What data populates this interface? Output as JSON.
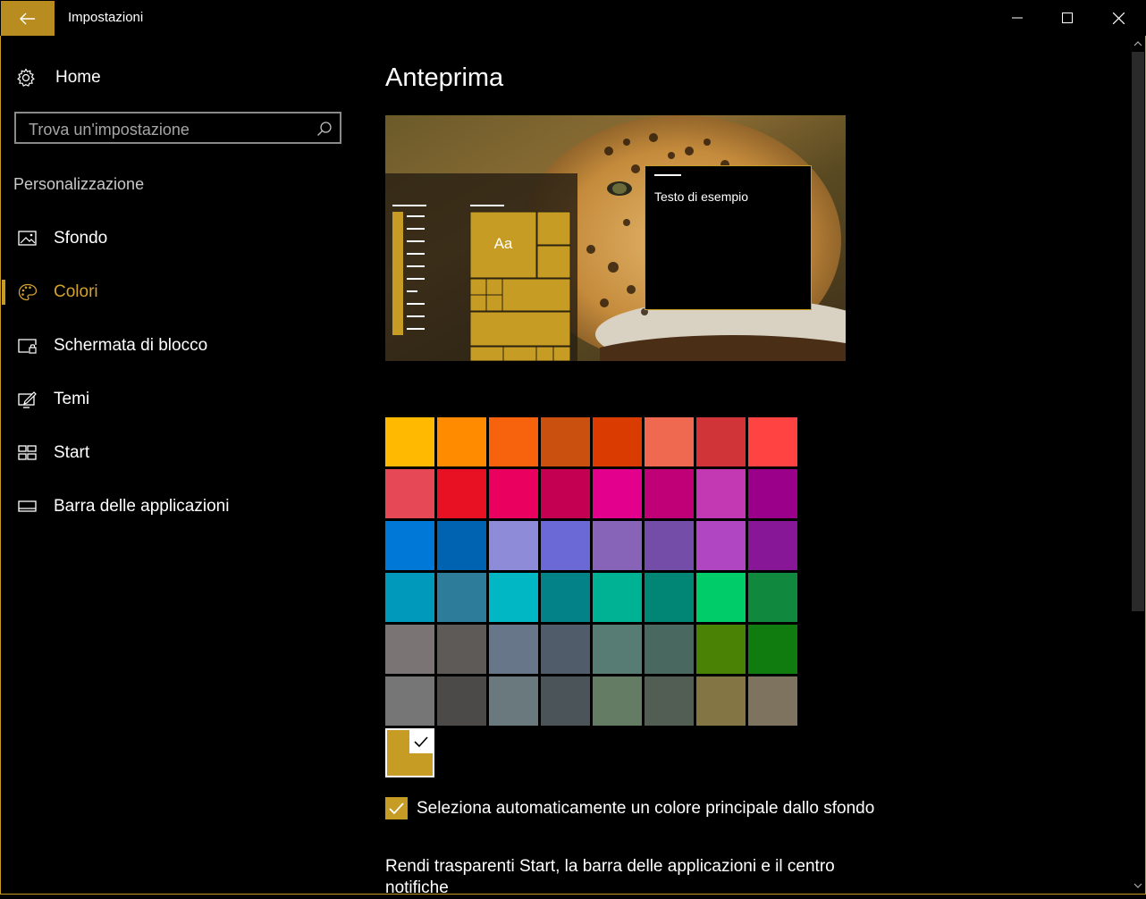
{
  "window": {
    "title": "Impostazioni"
  },
  "sidebar": {
    "home_label": "Home",
    "search_placeholder": "Trova un'impostazione",
    "section_label": "Personalizzazione",
    "items": [
      {
        "label": "Sfondo",
        "icon": "picture-icon"
      },
      {
        "label": "Colori",
        "icon": "palette-icon",
        "active": true
      },
      {
        "label": "Schermata di blocco",
        "icon": "lock-screen-icon"
      },
      {
        "label": "Temi",
        "icon": "themes-icon"
      },
      {
        "label": "Start",
        "icon": "start-icon"
      },
      {
        "label": "Barra delle applicazioni",
        "icon": "taskbar-icon"
      }
    ]
  },
  "main": {
    "heading": "Anteprima",
    "preview": {
      "aa_label": "Aa",
      "sample_text": "Testo di esempio"
    },
    "accent_color": "#c69c25",
    "palette": [
      [
        "#ffb900",
        "#ff8c00",
        "#f7630c",
        "#ca5010",
        "#da3b01",
        "#ef6950",
        "#d13438",
        "#ff4343"
      ],
      [
        "#e74856",
        "#e81123",
        "#ea005e",
        "#c30052",
        "#e3008c",
        "#bf0077",
        "#c239b3",
        "#9a0089"
      ],
      [
        "#0078d7",
        "#0063b1",
        "#8e8cd8",
        "#6b69d6",
        "#8764b8",
        "#744da9",
        "#b146c2",
        "#881798"
      ],
      [
        "#0099bc",
        "#2d7d9a",
        "#00b7c3",
        "#038387",
        "#00b294",
        "#018574",
        "#00cc6a",
        "#10893e"
      ],
      [
        "#7a7574",
        "#5d5a58",
        "#68768a",
        "#515c6b",
        "#567c73",
        "#486860",
        "#498205",
        "#107c10"
      ],
      [
        "#767676",
        "#4c4a48",
        "#69797e",
        "#4a5459",
        "#647c64",
        "#525e54",
        "#847545",
        "#7e735f"
      ]
    ],
    "auto_color_checkbox": {
      "label": "Seleziona automaticamente un colore principale dallo sfondo",
      "checked": true
    },
    "transparency_label": "Rendi trasparenti Start, la barra delle applicazioni e il centro notifiche"
  }
}
